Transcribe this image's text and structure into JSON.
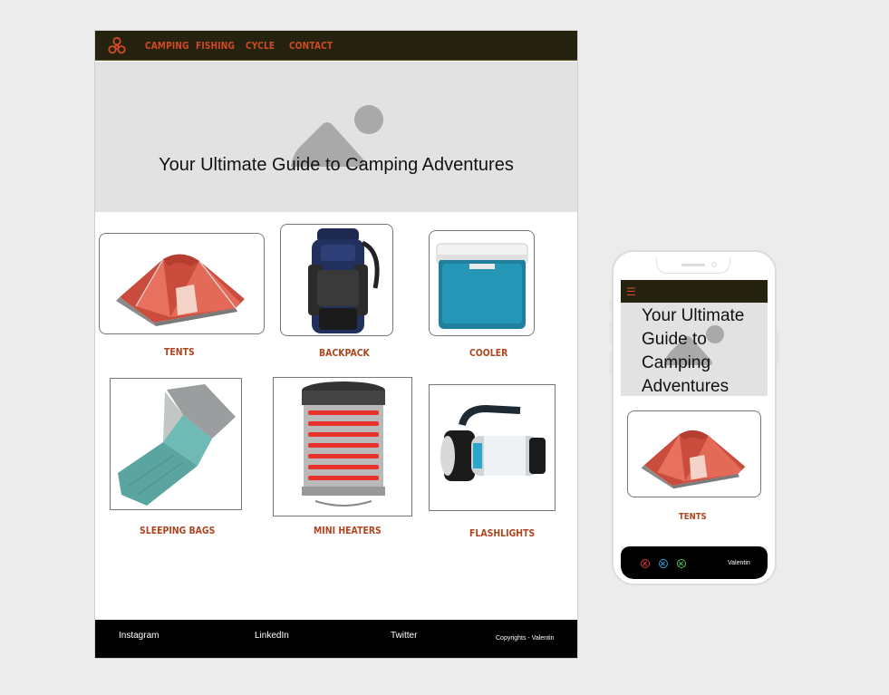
{
  "desktop": {
    "nav": {
      "links": [
        "CAMPING",
        "FISHING",
        "CYCLE",
        "CONTACT"
      ]
    },
    "hero": {
      "title": "Your Ultimate Guide to Camping Adventures"
    },
    "products": [
      {
        "label": "TENTS",
        "icon": "tent-image"
      },
      {
        "label": "BACKPACK",
        "icon": "backpack-image"
      },
      {
        "label": "COOLER",
        "icon": "cooler-image"
      },
      {
        "label": "SLEEPING BAGS",
        "icon": "sleeping-bag-image"
      },
      {
        "label": "MINI HEATERS",
        "icon": "heater-image"
      },
      {
        "label": "FLASHLIGHTS",
        "icon": "flashlight-image"
      }
    ],
    "footer": {
      "links": [
        "Instagram",
        "LinkedIn",
        "Twitter"
      ],
      "copyright": "Copyrights - Valentin"
    }
  },
  "mobile": {
    "hero_title": "Your Ultimate Guide to Camping Adventures",
    "product_label": "TENTS",
    "footer_credit": "Valentin",
    "icons": [
      "close-red-icon",
      "close-blue-icon",
      "close-green-icon"
    ]
  },
  "colors": {
    "nav_bg": "#25230f",
    "accent": "#d24a24",
    "label": "#b0441e",
    "hero_bg": "#e2e2e2",
    "footer_bg": "#000000"
  }
}
